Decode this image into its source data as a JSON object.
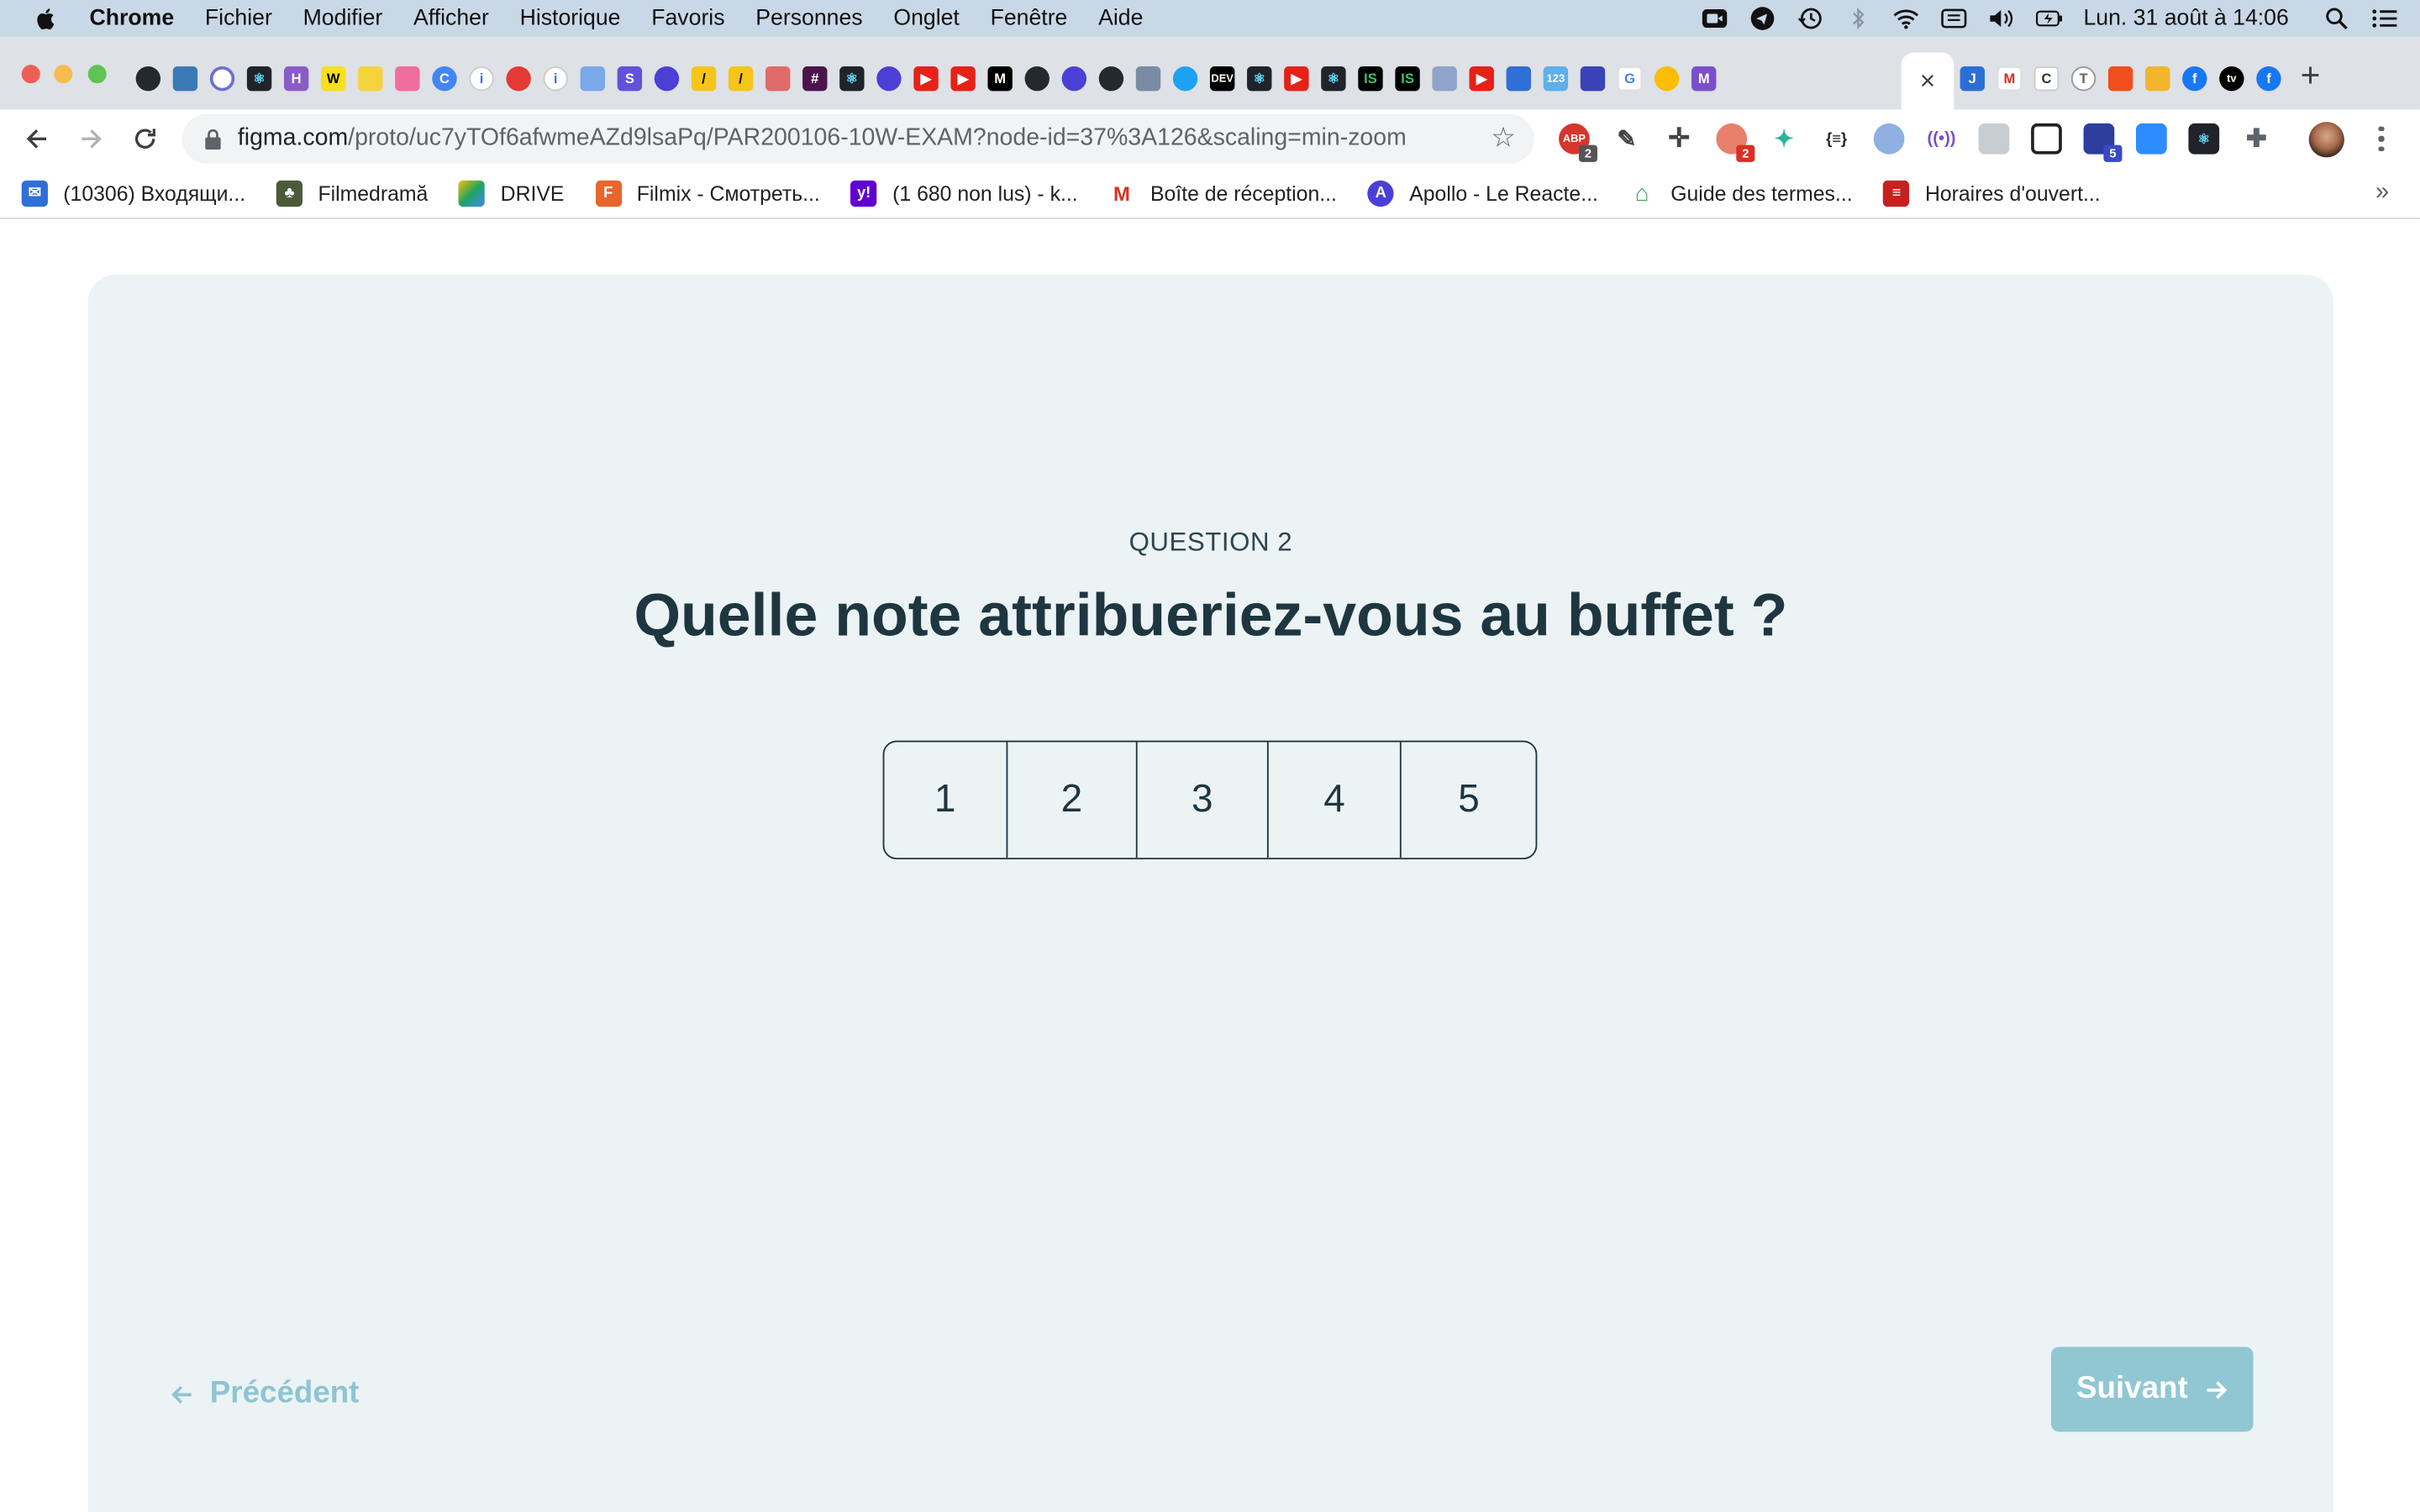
{
  "menubar": {
    "app_name": "Chrome",
    "items": [
      "Fichier",
      "Modifier",
      "Afficher",
      "Historique",
      "Favoris",
      "Personnes",
      "Onglet",
      "Fenêtre",
      "Aide"
    ],
    "clock": "Lun. 31 août à 14:06",
    "status_icons": [
      "video-camera-icon",
      "telegram-icon",
      "time-machine-icon",
      "bluetooth-icon",
      "wifi-icon",
      "keyboard-icon",
      "volume-icon",
      "battery-charging-icon",
      "spotlight-icon",
      "control-center-icon"
    ]
  },
  "tabs": {
    "active_close_label": "×",
    "new_tab_label": "+"
  },
  "toolbar": {
    "url_host": "figma.com",
    "url_path": "/proto/uc7yTOf6afwmeAZd9lsaPq/PAR200106-10W-EXAM?node-id=37%3A126&scaling=min-zoom",
    "extension_badges": {
      "adblock": "2",
      "ext_red": "2",
      "ext_blue": "5"
    }
  },
  "bookmarks": [
    {
      "label": "(10306) Входящи...",
      "icon": "mail-icon",
      "color": "#2f6fd6"
    },
    {
      "label": "Filmedramă",
      "icon": "film-icon",
      "color": "#4b5b3a"
    },
    {
      "label": "DRIVE",
      "icon": "google-drive-icon",
      "color": "#1fa463"
    },
    {
      "label": "Filmix - Смотреть...",
      "icon": "filmix-icon",
      "color": "#e8652b"
    },
    {
      "label": "(1 680 non lus) - k...",
      "icon": "yahoo-icon",
      "color": "#6001d2"
    },
    {
      "label": "Boîte de réception...",
      "icon": "gmail-icon",
      "color": "#d93025"
    },
    {
      "label": "Apollo - Le Reacte...",
      "icon": "apollo-icon",
      "color": "#4b3fd6"
    },
    {
      "label": "Guide des termes...",
      "icon": "home-icon",
      "color": "#34a853"
    },
    {
      "label": "Horaires d'ouvert...",
      "icon": "store-icon",
      "color": "#c5221f"
    }
  ],
  "bookmarks_overflow": "»",
  "survey": {
    "question_number": "QUESTION 2",
    "question": "Quelle note attribueriez-vous au buffet ?",
    "ratings": [
      "1",
      "2",
      "3",
      "4",
      "5"
    ],
    "prev_label": "Précédent",
    "next_label": "Suivant",
    "colors": {
      "card_bg": "#ebf3f5",
      "text": "#1e3640",
      "button": "#91c7d3",
      "prev_text": "#8fc4d2"
    }
  }
}
